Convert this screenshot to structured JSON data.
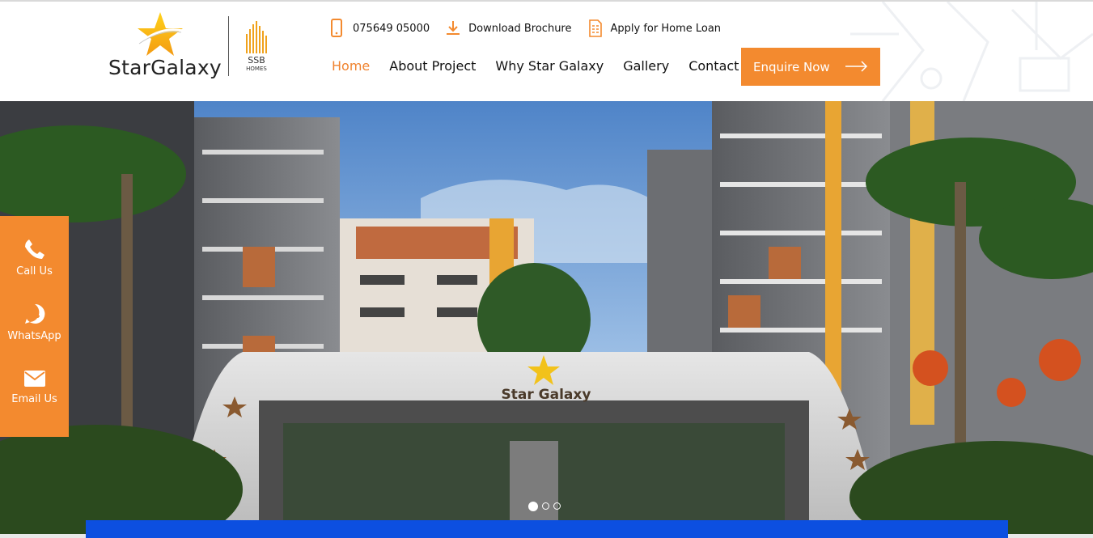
{
  "brand": {
    "logo_text": "StarGalaxy",
    "partner_logo_top": "SSB",
    "partner_logo_bottom": "HOMES"
  },
  "utility": {
    "phone": "075649 05000",
    "brochure": "Download Brochure",
    "loan": "Apply for Home Loan"
  },
  "nav": {
    "items": [
      {
        "label": "Home",
        "active": true
      },
      {
        "label": "About Project"
      },
      {
        "label": "Why Star Galaxy"
      },
      {
        "label": "Gallery"
      },
      {
        "label": "Contact"
      }
    ],
    "cta": "Enquire Now"
  },
  "hero": {
    "gate_sign": "Star Galaxy",
    "slides": 3,
    "active_slide": 1
  },
  "side_actions": [
    {
      "label": "Call Us",
      "icon": "phone-icon"
    },
    {
      "label": "WhatsApp",
      "icon": "whatsapp-icon"
    },
    {
      "label": "Email Us",
      "icon": "envelope-icon"
    }
  ],
  "colors": {
    "accent": "#f38a2f",
    "active_nav": "#f0832f",
    "blue_bar": "#0c4fe0",
    "text": "#111111"
  }
}
